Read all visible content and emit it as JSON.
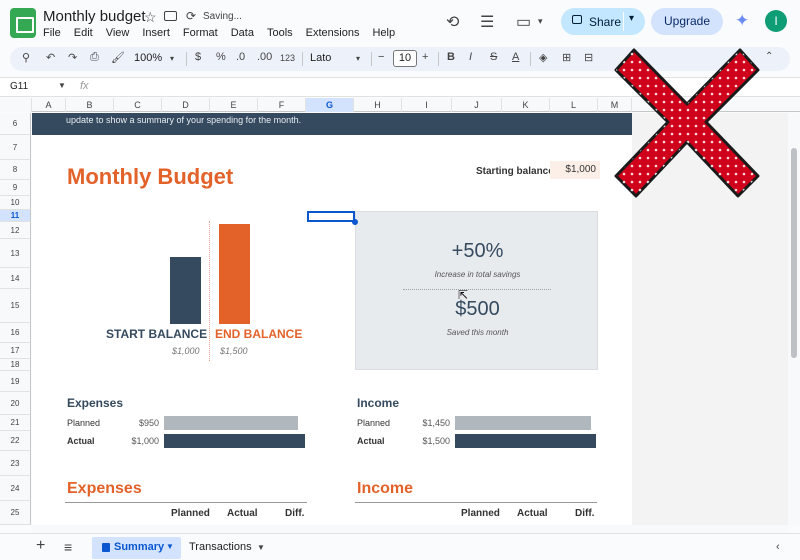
{
  "app": {
    "doc_title": "Monthly budget",
    "saving_status": "Saving...",
    "menu": [
      "File",
      "Edit",
      "View",
      "Insert",
      "Format",
      "Data",
      "Tools",
      "Extensions",
      "Help"
    ],
    "share_label": "Share",
    "upgrade_label": "Upgrade",
    "avatar_letter": "I"
  },
  "toolbar": {
    "zoom": "100%",
    "currency": "$",
    "percent": "%",
    "dec_decrease": ".0",
    "dec_increase": ".00",
    "number_format": "123",
    "font": "Lato",
    "font_size": "10",
    "minus": "−",
    "plus": "+"
  },
  "formula_bar": {
    "name_box": "G11",
    "fx": "fx"
  },
  "columns": [
    "A",
    "B",
    "C",
    "D",
    "E",
    "F",
    "G",
    "H",
    "I",
    "J",
    "K",
    "L",
    "M"
  ],
  "rows": [
    "6",
    "7",
    "8",
    "9",
    "10",
    "11",
    "12",
    "13",
    "14",
    "15",
    "16",
    "17",
    "18",
    "19",
    "20",
    "21",
    "22",
    "23",
    "24",
    "25"
  ],
  "selected_cell": {
    "column": "G",
    "row": "11"
  },
  "sheet": {
    "banner_text": "update to show a summary of your spending for the month.",
    "title": "Monthly Budget",
    "starting_balance_label": "Starting balance:",
    "starting_balance_value": "$1,000",
    "chart": {
      "start_label": "START BALANCE",
      "start_value_text": "$1,000",
      "end_label": "END BALANCE",
      "end_value_text": "$1,500"
    },
    "summary": {
      "pct": "+50%",
      "pct_caption": "Increase in total savings",
      "saved": "$500",
      "saved_caption": "Saved this month"
    },
    "expenses": {
      "title": "Expenses",
      "planned_label": "Planned",
      "planned_value": "$950",
      "actual_label": "Actual",
      "actual_value": "$1,000"
    },
    "income": {
      "title": "Income",
      "planned_label": "Planned",
      "planned_value": "$1,450",
      "actual_label": "Actual",
      "actual_value": "$1,500"
    },
    "expenses_table": {
      "title": "Expenses",
      "cols": [
        "Planned",
        "Actual",
        "Diff."
      ]
    },
    "income_table": {
      "title": "Income",
      "cols": [
        "Planned",
        "Actual",
        "Diff."
      ]
    }
  },
  "tabs": {
    "summary": "Summary",
    "transactions": "Transactions"
  },
  "colors": {
    "accent_orange": "#e2622a",
    "navy": "#354a5f",
    "planned_gray": "#b0b7bd",
    "x_red": "#d0021b"
  }
}
